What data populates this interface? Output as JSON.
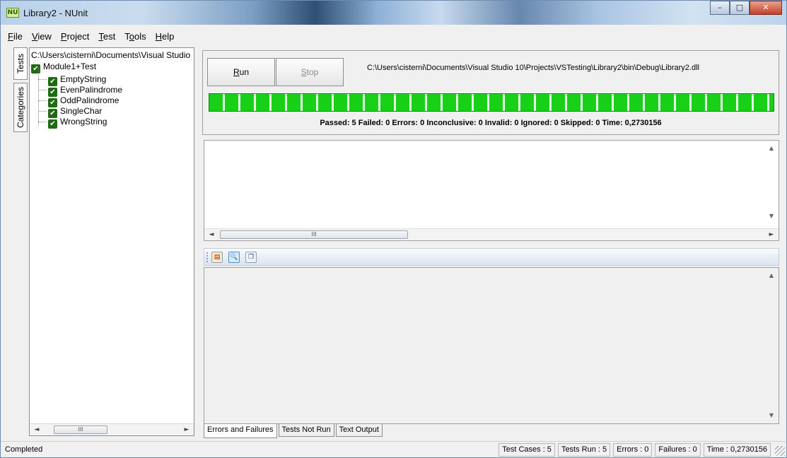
{
  "window": {
    "title": "Library2 - NUnit",
    "app_icon_text": "NU",
    "controls": {
      "minimize": "–",
      "maximize": "□",
      "close": "✕"
    }
  },
  "menu": [
    {
      "pre": "",
      "u": "F",
      "post": "ile"
    },
    {
      "pre": "",
      "u": "V",
      "post": "iew"
    },
    {
      "pre": "",
      "u": "P",
      "post": "roject"
    },
    {
      "pre": "",
      "u": "T",
      "post": "est"
    },
    {
      "pre": "T",
      "u": "o",
      "post": "ols"
    },
    {
      "pre": "",
      "u": "H",
      "post": "elp"
    }
  ],
  "side_tabs": {
    "tests": "Tests",
    "categories": "Categories"
  },
  "tree": {
    "root": "C:\\Users\\cisterni\\Documents\\Visual Studio",
    "fixture": "Module1+Test",
    "tests": [
      "EmptyString",
      "EvenPalindrome",
      "OddPalindrome",
      "SingleChar",
      "WrongString"
    ],
    "check_glyph": "✔",
    "scroll_glyph": "III"
  },
  "run_panel": {
    "run": {
      "u": "R",
      "post": "un"
    },
    "stop": {
      "u": "S",
      "post": "top"
    },
    "assembly_path": "C:\\Users\\cisterni\\Documents\\Visual Studio 10\\Projects\\VSTesting\\Library2\\bin\\Debug\\Library2.dll",
    "progress_percent": 100,
    "progress_color": "#18d018",
    "summary": "Passed: 5  Failed: 0  Errors: 0  Inconclusive: 0  Invalid: 0  Ignored: 0  Skipped: 0  Time: 0,2730156"
  },
  "scroll": {
    "left": "◄",
    "right": "►",
    "up": "▲",
    "down": "▼",
    "thumb": "III"
  },
  "toolbar": {
    "b1": "▤",
    "b2": "🔍",
    "b3": "❐"
  },
  "bottom_tabs": [
    "Errors and Failures",
    "Tests Not Run",
    "Text Output"
  ],
  "status": {
    "text": "Completed",
    "test_cases": "Test Cases : 5",
    "tests_run": "Tests Run : 5",
    "errors": "Errors : 0",
    "failures": "Failures : 0",
    "time": "Time : 0,2730156"
  }
}
